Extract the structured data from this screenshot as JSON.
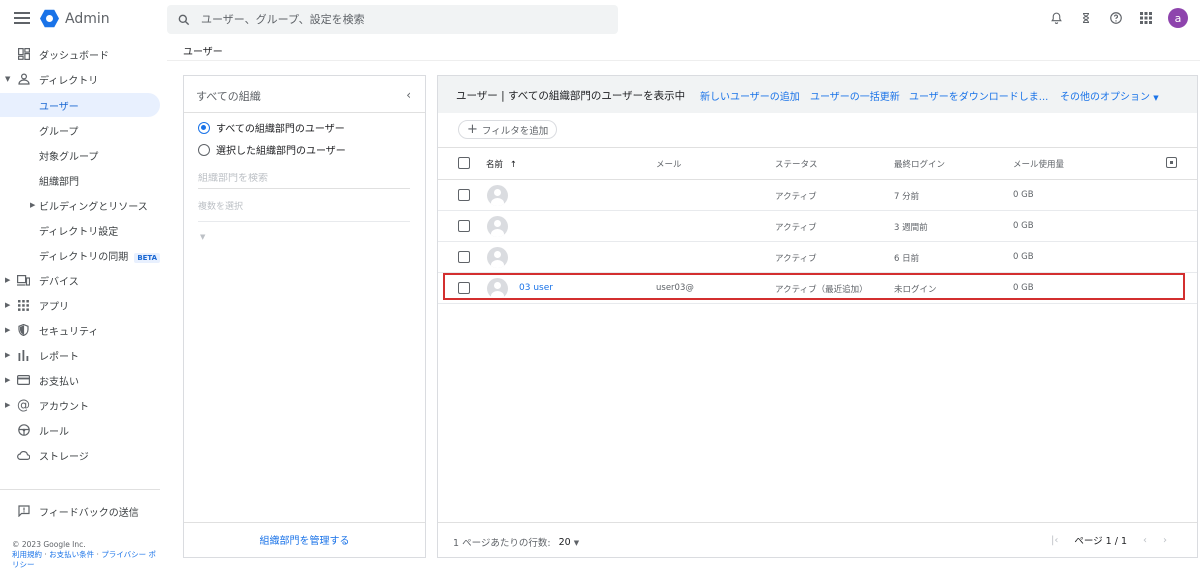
{
  "app": {
    "name": "Admin"
  },
  "search": {
    "placeholder": "ユーザー、グループ、設定を検索"
  },
  "account": {
    "avatar_letter": "a",
    "avatar_color": "#8e44ad"
  },
  "breadcrumb": "ユーザー",
  "sidebar": {
    "items": [
      {
        "label": "ダッシュボード",
        "icon": "dashboard-icon"
      },
      {
        "label": "ディレクトリ",
        "icon": "person-icon",
        "expanded": true
      },
      {
        "label": "ユーザー",
        "active": true
      },
      {
        "label": "グループ"
      },
      {
        "label": "対象グループ"
      },
      {
        "label": "組織部門"
      },
      {
        "label": "ビルディングとリソース",
        "collapsed": true
      },
      {
        "label": "ディレクトリ設定"
      },
      {
        "label": "ディレクトリの同期",
        "badge": "BETA"
      },
      {
        "label": "デバイス",
        "icon": "devices-icon",
        "collapsed": true
      },
      {
        "label": "アプリ",
        "icon": "apps-grid-icon",
        "collapsed": true
      },
      {
        "label": "セキュリティ",
        "icon": "shield-icon",
        "collapsed": true
      },
      {
        "label": "レポート",
        "icon": "bar-chart-icon",
        "collapsed": true
      },
      {
        "label": "お支払い",
        "icon": "credit-card-icon",
        "collapsed": true
      },
      {
        "label": "アカウント",
        "icon": "at-sign-icon",
        "collapsed": true
      },
      {
        "label": "ルール",
        "icon": "steering-icon"
      },
      {
        "label": "ストレージ",
        "icon": "cloud-icon"
      }
    ],
    "feedback": "フィードバックの送信",
    "copyright": "© 2023 Google Inc.",
    "links": [
      "利用規約",
      "お支払い条件",
      "プライバシー ポリシー"
    ]
  },
  "org_panel": {
    "title": "すべての組織",
    "option_all": "すべての組織部門のユーザー",
    "option_selected": "選択した組織部門のユーザー",
    "search_placeholder": "組織部門を検索",
    "multi_select": "複数を選択",
    "manage": "組織部門を管理する"
  },
  "users_panel": {
    "title": "ユーザー | すべての組織部門のユーザーを表示中",
    "actions": {
      "add": "新しいユーザーの追加",
      "bulk_update": "ユーザーの一括更新",
      "download": "ユーザーをダウンロードしま...",
      "more": "その他のオプション"
    },
    "filter": "フィルタを追加",
    "columns": {
      "name": "名前",
      "email": "メール",
      "status": "ステータス",
      "last_login": "最終ログイン",
      "storage": "メール使用量"
    },
    "rows": [
      {
        "name": "",
        "email": "",
        "status": "アクティブ",
        "last_login": "7 分前",
        "storage": "0 GB"
      },
      {
        "name": "",
        "email": "",
        "status": "アクティブ",
        "last_login": "3 週間前",
        "storage": "0 GB"
      },
      {
        "name": "",
        "email": "",
        "status": "アクティブ",
        "last_login": "6 日前",
        "storage": "0 GB"
      },
      {
        "name": "03 user",
        "email": "user03@",
        "status": "アクティブ（最近追加）",
        "last_login": "未ログイン",
        "storage": "0 GB"
      }
    ],
    "rows_per_page_label": "1 ページあたりの行数:",
    "rows_per_page": "20",
    "page_label": "ページ 1 / 1"
  }
}
